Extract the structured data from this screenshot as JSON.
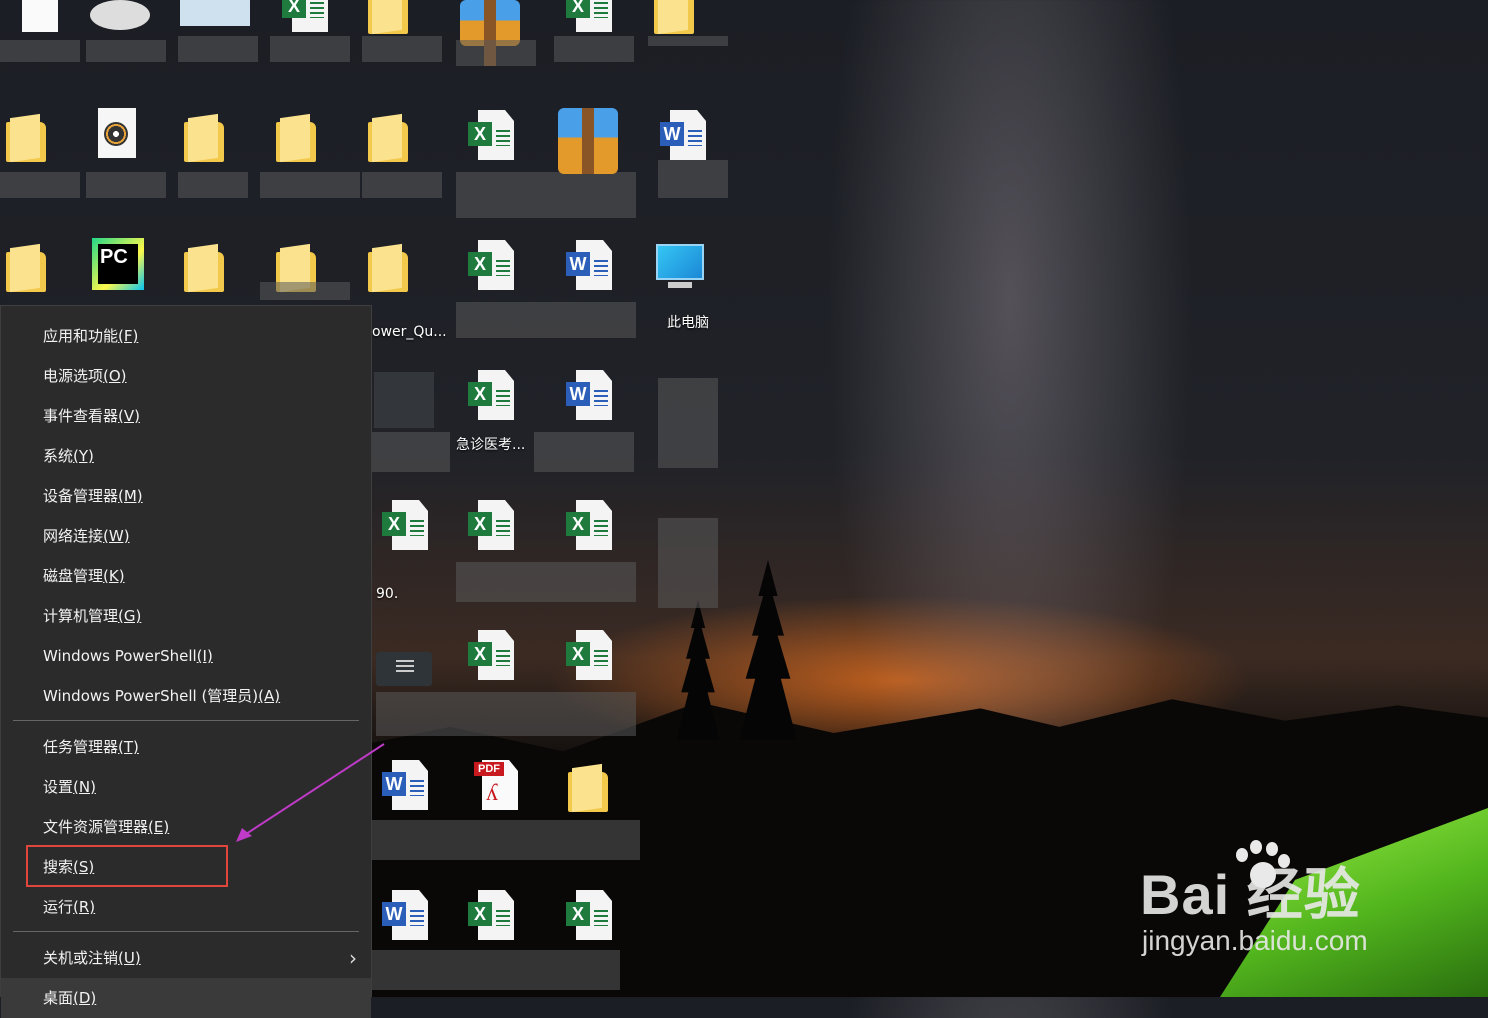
{
  "desktop": {
    "this_pc_label": "此电脑",
    "partial_labels": [
      "ower_Qu...",
      "90.",
      "急诊医考..."
    ]
  },
  "context_menu": {
    "group1": [
      {
        "label": "应用和功能",
        "key": "(F)"
      },
      {
        "label": "电源选项",
        "key": "(O)"
      },
      {
        "label": "事件查看器",
        "key": "(V)"
      },
      {
        "label": "系统",
        "key": "(Y)"
      },
      {
        "label": "设备管理器",
        "key": "(M)"
      },
      {
        "label": "网络连接",
        "key": "(W)"
      },
      {
        "label": "磁盘管理",
        "key": "(K)"
      },
      {
        "label": "计算机管理",
        "key": "(G)"
      },
      {
        "label": "Windows PowerShell",
        "key": "(I)"
      },
      {
        "label": "Windows PowerShell (管理员)",
        "key": "(A)"
      }
    ],
    "group2": [
      {
        "label": "任务管理器",
        "key": "(T)"
      },
      {
        "label": "设置",
        "key": "(N)"
      },
      {
        "label": "文件资源管理器",
        "key": "(E)"
      },
      {
        "label": "搜索",
        "key": "(S)"
      },
      {
        "label": "运行",
        "key": "(R)"
      }
    ],
    "group3": [
      {
        "label": "关机或注销",
        "key": "(U)"
      },
      {
        "label": "桌面",
        "key": "(D)"
      }
    ],
    "highlight_item": "搜索(S)",
    "highlight_color": "#e0463b",
    "arrow_color": "#c03ac8"
  },
  "watermark": {
    "brand": "Bai  经验",
    "url": "jingyan.baidu.com"
  }
}
